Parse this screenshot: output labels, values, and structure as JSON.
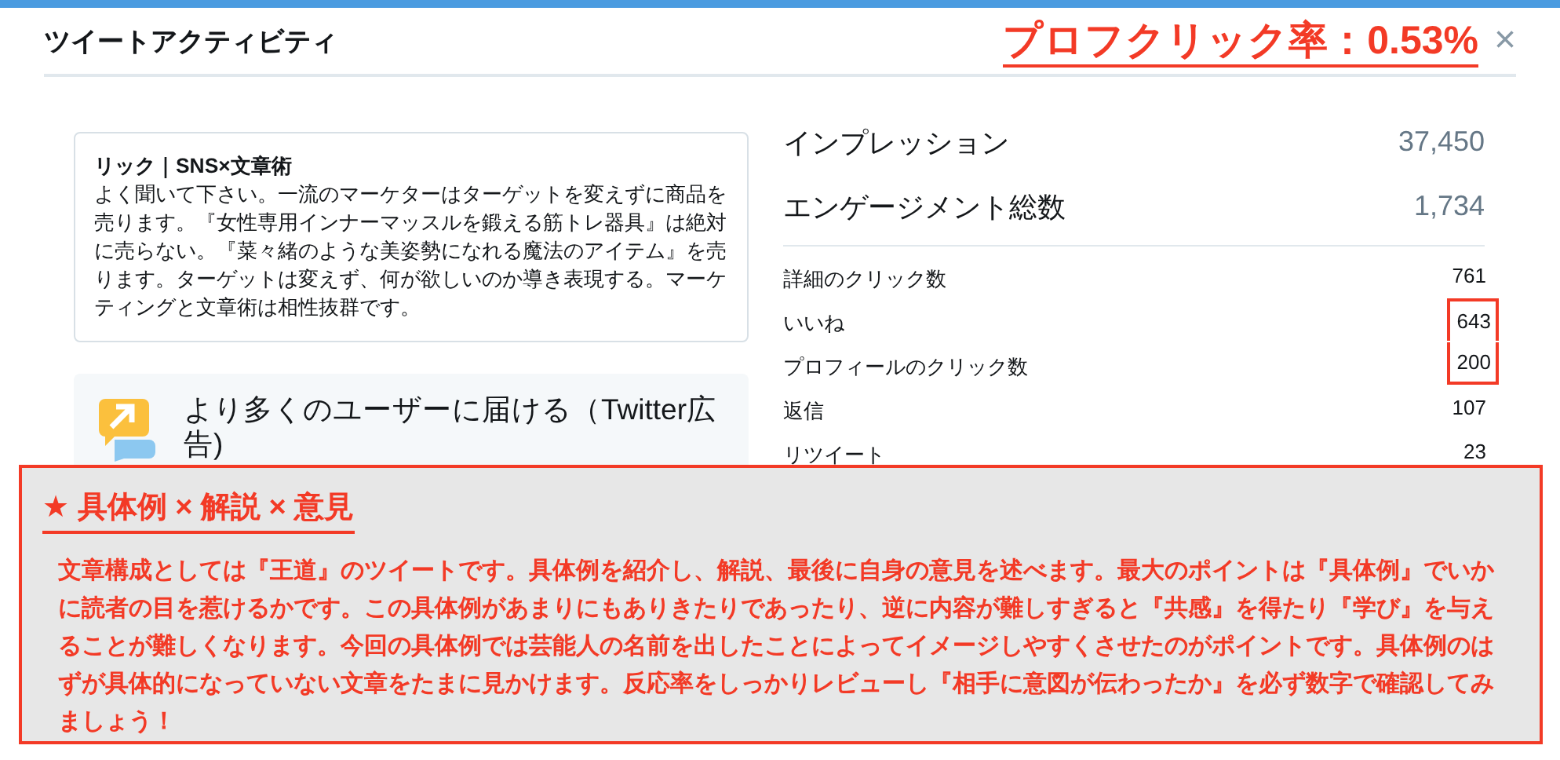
{
  "header": {
    "title": "ツイートアクティビティ",
    "annotation": "プロフクリック率：0.53%",
    "close": "×"
  },
  "tweet": {
    "author": "リック｜SNS×文章術",
    "text": "よく聞いて下さい。一流のマーケターはターゲットを変えずに商品を売ります。『女性専用インナーマッスルを鍛える筋トレ器具』は絶対に売らない。『菜々緒のような美姿勢になれる魔法のアイテム』を売ります。ターゲットは変えず、何が欲しいのか導き表現する。マーケティングと文章術は相性抜群です。"
  },
  "promo": {
    "title": "より多くのユーザーに届ける（Twitter広告)"
  },
  "summary": [
    {
      "label": "インプレッション",
      "value": "37,450"
    },
    {
      "label": "エンゲージメント総数",
      "value": "1,734"
    }
  ],
  "metrics": [
    {
      "label": "詳細のクリック数",
      "value": "761",
      "highlighted": false
    },
    {
      "label": "いいね",
      "value": "643",
      "highlighted": true
    },
    {
      "label": "プロフィールのクリック数",
      "value": "200",
      "highlighted": true
    },
    {
      "label": "返信",
      "value": "107",
      "highlighted": false
    },
    {
      "label": "リツイート",
      "value": "23",
      "highlighted": false
    }
  ],
  "note": {
    "heading": "★ 具体例 × 解説 × 意見",
    "text": "文章構成としては『王道』のツイートです。具体例を紹介し、解説、最後に自身の意見を述べます。最大のポイントは『具体例』でいかに読者の目を惹けるかです。この具体例があまりにもありきたりであったり、逆に内容が難しすぎると『共感』を得たり『学び』を与えることが難しくなります。今回の具体例では芸能人の名前を出したことによってイメージしやすくさせたのがポイントです。具体例のはずが具体的になっていない文章をたまに見かけます。反応率をしっかりレビューし『相手に意図が伝わったか』を必ず数字で確認してみましょう！"
  }
}
